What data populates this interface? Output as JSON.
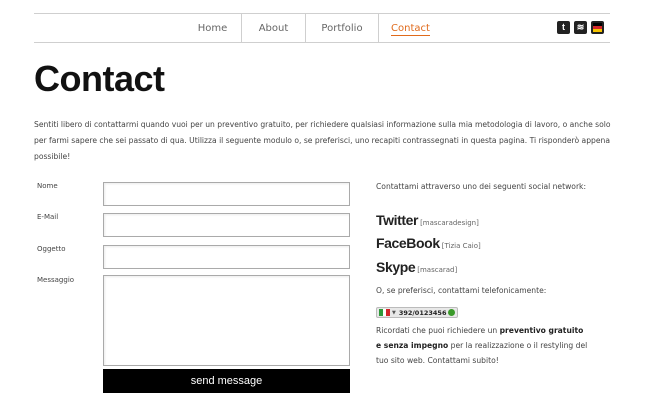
{
  "nav": {
    "items": [
      {
        "label": "Home"
      },
      {
        "label": "About"
      },
      {
        "label": "Portfolio"
      },
      {
        "label": "Contact",
        "active": true
      }
    ],
    "social_icons": [
      "twitter-icon",
      "rss-icon",
      "flag-icon"
    ],
    "social_glyphs": {
      "twitter": "t",
      "rss": "≋"
    }
  },
  "page": {
    "title": "Contact",
    "intro": "Sentiti libero di contattarmi quando vuoi per un preventivo gratuito, per richiedere qualsiasi informazione sulla mia metodologia di lavoro, o anche solo per farmi sapere che sei passato di qua. Utilizza il seguente modulo o, se preferisci, uno recapiti contrassegnati in questa pagina. Ti risponderò appena possibile!"
  },
  "form": {
    "name_label": "Nome",
    "email_label": "E-Mail",
    "subject_label": "Oggetto",
    "message_label": "Messaggio",
    "name_value": "",
    "email_value": "",
    "subject_value": "",
    "message_value": "",
    "submit_label": "send message"
  },
  "sidebar": {
    "intro": "Contattami attraverso uno dei seguenti social network:",
    "networks": [
      {
        "name": "Twitter",
        "handle": "[mascaradesign]"
      },
      {
        "name": "FaceBook",
        "handle": "[Tizia Caio]"
      },
      {
        "name": "Skype",
        "handle": "[mascarad]"
      }
    ],
    "phone_intro": "O, se preferisci, contattami telefonicamente:",
    "phone_number": "392/0123456",
    "closing_before": "Ricordati che puoi richiedere un ",
    "closing_bold": "preventivo gratuito e senza impegno",
    "closing_after": " per la realizzazione o il restyling del tuo sito web. Contattami subito!"
  },
  "colors": {
    "accent": "#e06a1b",
    "button_bg": "#000000",
    "divider": "#cfcfcf",
    "flag_green": "#2e9a3a",
    "flag_white": "#ffffff",
    "flag_red": "#d3262b",
    "flag_black": "#000000",
    "flag_gold": "#f5c400"
  }
}
